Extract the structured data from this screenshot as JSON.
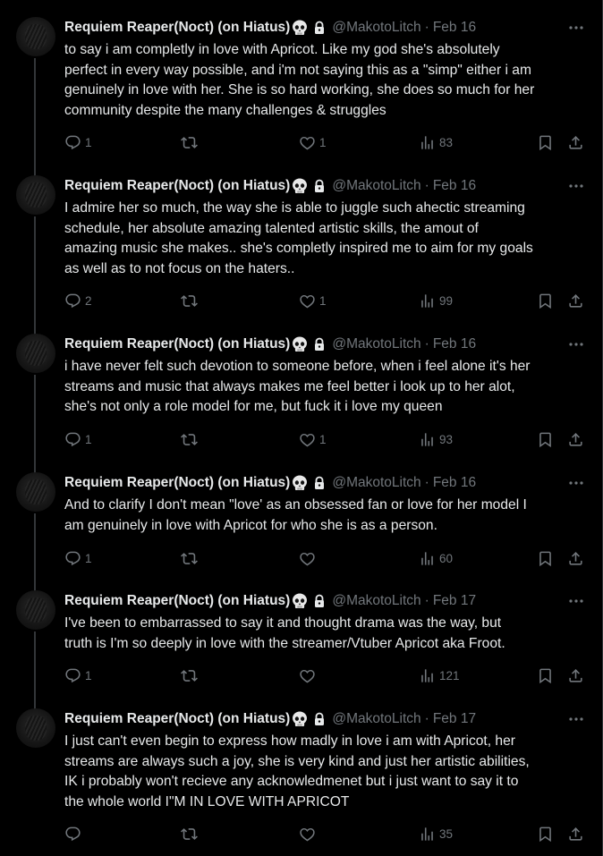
{
  "author": {
    "name": "Requiem Reaper(Noct) (on Hiatus)",
    "handle": "@MakotoLitch"
  },
  "icons": {
    "more": "more-icon",
    "reply": "reply-icon",
    "retweet": "retweet-icon",
    "like": "like-icon",
    "views": "views-icon",
    "bookmark": "bookmark-icon",
    "share": "share-icon"
  },
  "tweets": [
    {
      "date": "Feb 16",
      "text": "to say i am completly in love with Apricot. Like my god she's absolutely\nperfect in every way possible, and i'm not saying this as a \"simp\" either i am\ngenuinely in love with her. She is so hard working, she does so much for her\ncommunity despite the many challenges & struggles",
      "replies": "1",
      "retweets": "",
      "likes": "1",
      "views": "83"
    },
    {
      "date": "Feb 16",
      "text": "I admire her so much, the way she is able to juggle such ahectic streaming\nschedule, her absolute amazing talented artistic skills,  the amout of\namazing music she makes.. she's completly inspired me to aim for my goals\nas well as to not focus on the haters..",
      "replies": "2",
      "retweets": "",
      "likes": "1",
      "views": "99"
    },
    {
      "date": "Feb 16",
      "text": "i have never felt such devotion to someone before, when i feel alone it's her\nstreams and music that always makes me feel better i look up to her alot,\nshe's not only a role model for me, but fuck it i love my queen",
      "replies": "1",
      "retweets": "",
      "likes": "1",
      "views": "93"
    },
    {
      "date": "Feb 16",
      "text": "And to clarify I don't mean \"love' as an obsessed fan or love for her model I\nam genuinely in love with Apricot for who she is as a person.",
      "replies": "1",
      "retweets": "",
      "likes": "",
      "views": "60"
    },
    {
      "date": "Feb 17",
      "text": "I've been to embarrassed to say it and thought drama was the way, but\ntruth is I'm so deeply in love with the streamer/Vtuber Apricot aka Froot.",
      "replies": "1",
      "retweets": "",
      "likes": "",
      "views": "121"
    },
    {
      "date": "Feb 17",
      "text": "I just can't even begin to express how madly in love i am with Apricot, her\nstreams are always such a joy, she is very kind and just her artistic abilities,\nIK i probably won't recieve any acknowledmenet but i just want to say it to\nthe whole world I\"M IN LOVE WITH APRICOT",
      "replies": "",
      "retweets": "",
      "likes": "",
      "views": "35"
    }
  ]
}
